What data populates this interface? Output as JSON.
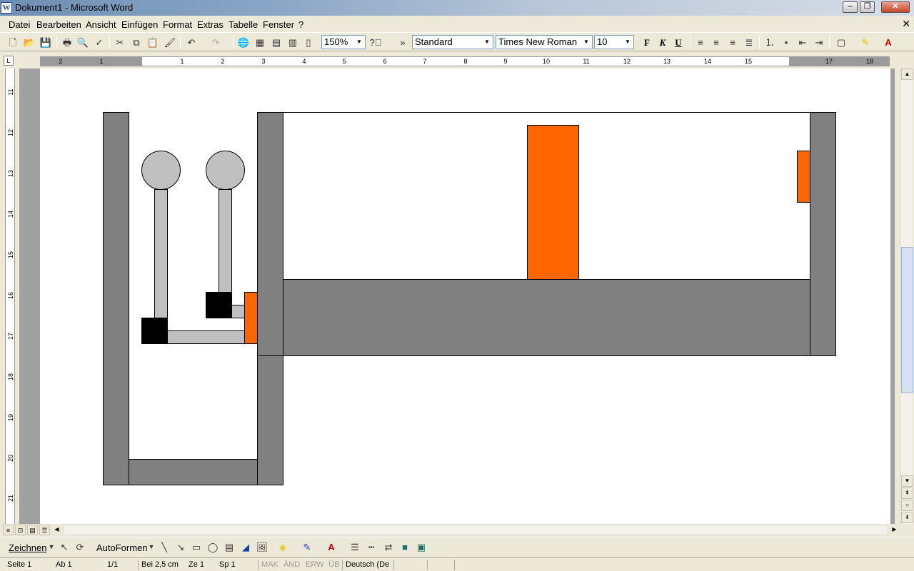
{
  "window": {
    "title": "Dokument1 - Microsoft Word",
    "app_icon": "W",
    "minimize": "–",
    "restore": "❐",
    "close": "✕"
  },
  "menu": {
    "items": [
      "Datei",
      "Bearbeiten",
      "Ansicht",
      "Einfügen",
      "Format",
      "Extras",
      "Tabelle",
      "Fenster",
      "?"
    ],
    "close_doc": "✕"
  },
  "toolbar": {
    "zoom": "150%",
    "style": "Standard",
    "font": "Times New Roman",
    "font_size": "10",
    "bold": "F",
    "italic": "K",
    "underline": "U"
  },
  "ruler": {
    "corner": "L",
    "h_numbers": [
      "2",
      "1",
      "1",
      "2",
      "3",
      "4",
      "5",
      "6",
      "7",
      "8",
      "9",
      "10",
      "11",
      "12",
      "13",
      "14",
      "15",
      "17",
      "18"
    ],
    "v_numbers": [
      "11",
      "12",
      "13",
      "14",
      "15",
      "16",
      "17",
      "18",
      "19",
      "20",
      "21"
    ]
  },
  "drawing_toolbar": {
    "draw_label": "Zeichnen",
    "autoshapes_label": "AutoFormen"
  },
  "status": {
    "page": "Seite  1",
    "section": "Ab  1",
    "pages": "1/1",
    "position": "Bei  2,5 cm",
    "line": "Ze  1",
    "column": "Sp  1",
    "rec": "MAK",
    "trk": "ÄND",
    "ext": "ERW",
    "ovr": "ÜB",
    "language": "Deutsch (De"
  },
  "colors": {
    "dark_gray": "#808080",
    "light_gray": "#c0c0c0",
    "orange": "#ff6600",
    "black": "#000000"
  }
}
